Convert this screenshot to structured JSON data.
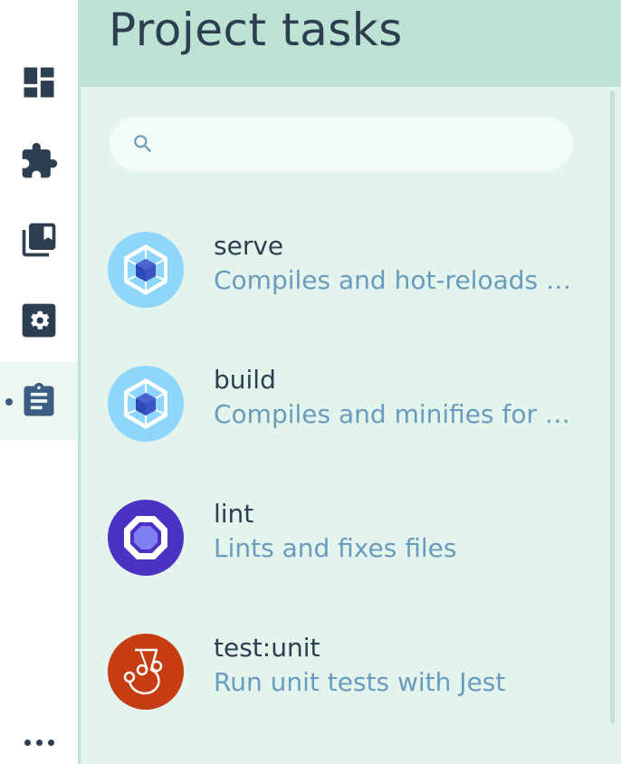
{
  "header": {
    "title": "Project tasks"
  },
  "nav": {
    "items": [
      {
        "id": "dashboard",
        "icon": "dashboard-icon"
      },
      {
        "id": "plugins",
        "icon": "puzzle-icon"
      },
      {
        "id": "dependencies",
        "icon": "library-books-icon"
      },
      {
        "id": "configuration",
        "icon": "gear-icon"
      },
      {
        "id": "tasks",
        "icon": "clipboard-icon",
        "active": true
      }
    ],
    "more_icon": "more-horizontal-icon"
  },
  "search": {
    "value": "",
    "placeholder": "",
    "icon": "search-icon"
  },
  "tasks": [
    {
      "name": "serve",
      "description": "Compiles and hot-reloads for development",
      "icon": "webpack-icon"
    },
    {
      "name": "build",
      "description": "Compiles and minifies for production",
      "icon": "webpack-icon"
    },
    {
      "name": "lint",
      "description": "Lints and fixes files",
      "icon": "eslint-icon"
    },
    {
      "name": "test:unit",
      "description": "Run unit tests with Jest",
      "icon": "jest-icon"
    }
  ],
  "colors": {
    "header_bg": "#bbe2d2",
    "panel_bg": "#e2f4ec",
    "text_primary": "#2c3e50",
    "text_secondary": "#6a9bbd",
    "webpack_bg": "#8ed6fb",
    "eslint_bg": "#4b32c3",
    "jest_bg": "#c63d14"
  }
}
